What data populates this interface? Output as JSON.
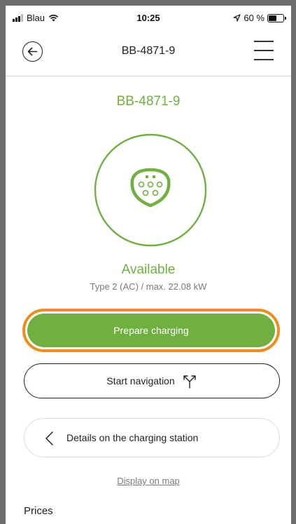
{
  "status_bar": {
    "carrier": "Blau",
    "time": "10:25",
    "battery_text": "60 %",
    "battery_level": 0.6
  },
  "header": {
    "title": "BB-4871-9",
    "back_icon": "back-arrow-icon",
    "menu_icon": "hamburger-menu-icon"
  },
  "station": {
    "title": "BB-4871-9",
    "connector_icon": "type2-connector-icon",
    "status": "Available",
    "type_info": "Type 2 (AC) / max. 22.08 kW"
  },
  "actions": {
    "prepare_label": "Prepare charging",
    "navigation_label": "Start navigation",
    "navigation_icon": "route-icon",
    "details_label": "Details on the charging station",
    "map_link": "Display on map"
  },
  "sections": {
    "prices_heading": "Prices"
  },
  "colors": {
    "accent_green": "#6fb040",
    "highlight_orange": "#f08c1b"
  }
}
